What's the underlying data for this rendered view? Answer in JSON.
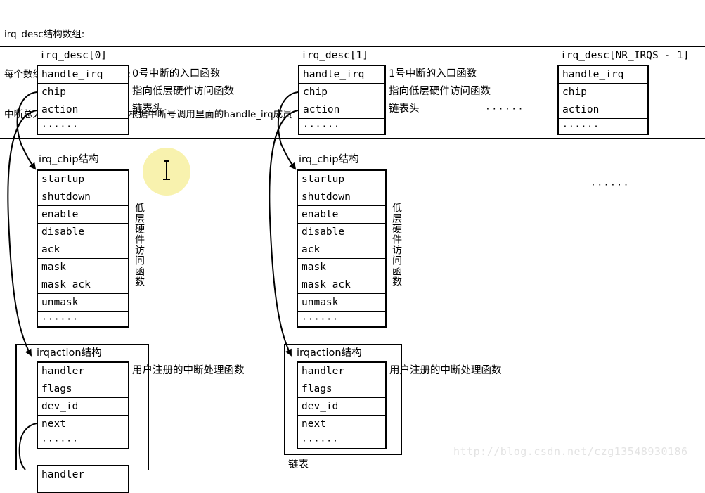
{
  "header": {
    "line1": "irq_desc结构数组:",
    "line2": "每个数组项用来描述一个中断;",
    "line3": "中断总入口函数asm_do_IRQ根据中断号调用里面的handle_irq成员"
  },
  "irq_desc": {
    "columns": [
      {
        "caption": "irq_desc[0]",
        "fields": [
          "handle_irq",
          "chip",
          "action",
          "······"
        ],
        "notes": [
          "0号中断的入口函数",
          "指向低层硬件访问函数",
          "链表头"
        ],
        "trailing_dots": ""
      },
      {
        "caption": "irq_desc[1]",
        "fields": [
          "handle_irq",
          "chip",
          "action",
          "······"
        ],
        "notes": [
          "1号中断的入口函数",
          "指向低层硬件访问函数",
          "链表头"
        ],
        "trailing_dots": "······"
      },
      {
        "caption": "irq_desc[NR_IRQS - 1]",
        "fields": [
          "handle_irq",
          "chip",
          "action",
          "······"
        ],
        "notes": [],
        "trailing_dots": ""
      }
    ]
  },
  "irq_chip": {
    "caption": "irq_chip结构",
    "fields": [
      "startup",
      "shutdown",
      "enable",
      "disable",
      "ack",
      "mask",
      "mask_ack",
      "unmask",
      "······"
    ],
    "side_label": "低层硬件访问函数",
    "middle_dots": "······"
  },
  "irqaction": {
    "caption": "irqaction结构",
    "fields": [
      "handler",
      "flags",
      "dev_id",
      "next",
      "······"
    ],
    "note": "用户注册的中断处理函数",
    "list_label": "链表"
  },
  "cursor": {
    "icon": "text-ibeam-cursor",
    "halo_color": "#f7f0a0"
  },
  "watermark": {
    "text": "http://blog.csdn.net/czg13548930186",
    "color": "#e3e3e3"
  }
}
